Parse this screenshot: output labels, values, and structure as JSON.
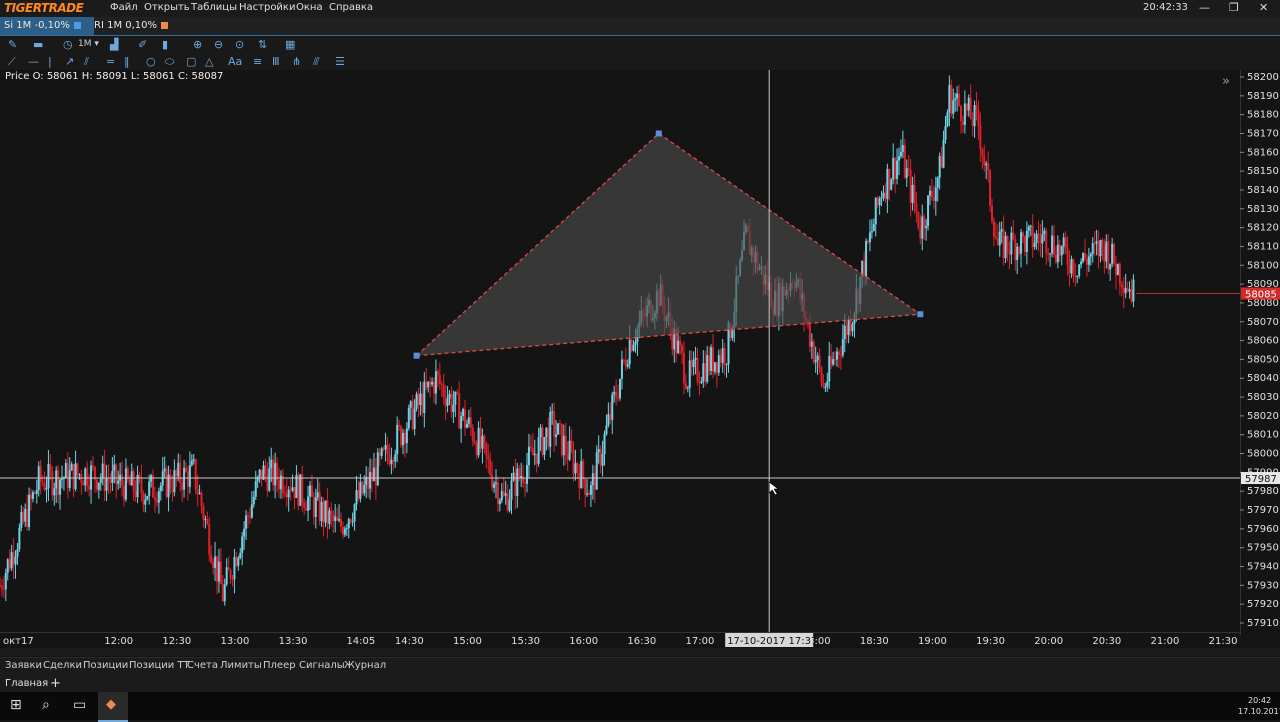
{
  "app": {
    "logo": "TIGERTRADE",
    "menu": [
      "Файл",
      "Открыть",
      "Таблицы",
      "Настройки",
      "Окна",
      "Справка"
    ],
    "clock": "20:42:33",
    "window_controls": [
      "—",
      "❐",
      "✕"
    ]
  },
  "tabs": [
    {
      "label": "Si 1M -0,10%",
      "close": "✕",
      "color": "#4a9de0",
      "active": true
    },
    {
      "label": "RI 1M 0,10%",
      "color": "#f08a4b",
      "active": false
    }
  ],
  "chart": {
    "price_info": "Price O: 58061 H: 58091 L: 58061 C: 58087",
    "collapse_icon": "»",
    "y_ticks": [
      "58200",
      "58190",
      "58180",
      "58170",
      "58160",
      "58150",
      "58140",
      "58130",
      "58120",
      "58110",
      "58100",
      "58090",
      "58080",
      "58070",
      "58060",
      "58050",
      "58040",
      "58030",
      "58020",
      "58010",
      "58000",
      "57990",
      "57980",
      "57970",
      "57960",
      "57950",
      "57940",
      "57930",
      "57920",
      "57910"
    ],
    "x_ticks": [
      "окт17",
      "12:00",
      "12:30",
      "13:00",
      "13:30",
      "14:05",
      "14:30",
      "15:00",
      "15:30",
      "16:00",
      "16:30",
      "17:00",
      "17:30",
      "18:00",
      "18:30",
      "19:00",
      "19:30",
      "20:00",
      "20:30",
      "21:00",
      "21:30"
    ],
    "current_price_label": "58085",
    "crosshair_price_label": "57987",
    "crosshair_time_label": "17-10-2017 17:37",
    "colors": {
      "up": "#6fd3e6",
      "down": "#e0202a",
      "triangle_fill": "#4a4a4a",
      "triangle_stroke": "#e04848",
      "handle": "#5b8fdd"
    }
  },
  "chart_data": {
    "type": "candlestick",
    "timeframe": "1M",
    "instrument": "Si",
    "ylim": [
      57910,
      58200
    ],
    "x_range": [
      "11:00",
      "21:40"
    ],
    "last_close": 58085,
    "crosshair": {
      "time": "17-10-2017 17:37",
      "price": 57987
    },
    "price_path": [
      {
        "time": "11:00",
        "price": 57930
      },
      {
        "time": "11:20",
        "price": 57985
      },
      {
        "time": "11:45",
        "price": 57990
      },
      {
        "time": "12:15",
        "price": 57980
      },
      {
        "time": "12:40",
        "price": 57990
      },
      {
        "time": "12:55",
        "price": 57925
      },
      {
        "time": "13:15",
        "price": 57990
      },
      {
        "time": "13:30",
        "price": 57985
      },
      {
        "time": "13:55",
        "price": 57960
      },
      {
        "time": "14:20",
        "price": 58000
      },
      {
        "time": "14:45",
        "price": 58040
      },
      {
        "time": "15:05",
        "price": 58010
      },
      {
        "time": "15:20",
        "price": 57975
      },
      {
        "time": "15:45",
        "price": 58015
      },
      {
        "time": "16:05",
        "price": 57980
      },
      {
        "time": "16:25",
        "price": 58060
      },
      {
        "time": "16:40",
        "price": 58085
      },
      {
        "time": "16:55",
        "price": 58040
      },
      {
        "time": "17:15",
        "price": 58055
      },
      {
        "time": "17:25",
        "price": 58115
      },
      {
        "time": "17:40",
        "price": 58080
      },
      {
        "time": "17:50",
        "price": 58095
      },
      {
        "time": "18:05",
        "price": 58035
      },
      {
        "time": "18:20",
        "price": 58075
      },
      {
        "time": "18:35",
        "price": 58140
      },
      {
        "time": "18:45",
        "price": 58160
      },
      {
        "time": "18:55",
        "price": 58120
      },
      {
        "time": "19:05",
        "price": 58150
      },
      {
        "time": "19:10",
        "price": 58190
      },
      {
        "time": "19:25",
        "price": 58175
      },
      {
        "time": "19:35",
        "price": 58110
      },
      {
        "time": "20:00",
        "price": 58115
      },
      {
        "time": "20:15",
        "price": 58100
      },
      {
        "time": "20:30",
        "price": 58110
      },
      {
        "time": "20:45",
        "price": 58085
      }
    ],
    "triangle_drawing": [
      {
        "time": "14:35",
        "price": 58052
      },
      {
        "time": "16:40",
        "price": 58170
      },
      {
        "time": "18:55",
        "price": 58074
      }
    ]
  }
}
